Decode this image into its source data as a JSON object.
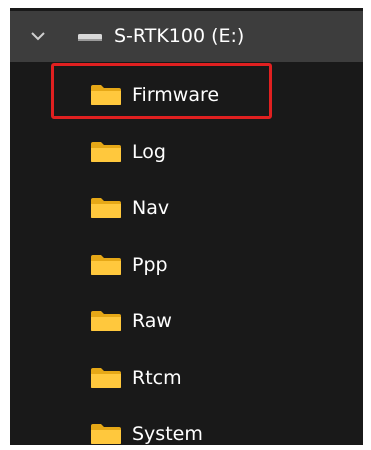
{
  "drive": {
    "label": "S-RTK100 (E:)",
    "icon": "drive-icon",
    "expand_icon": "chevron-down-icon"
  },
  "folders": [
    {
      "label": "Firmware",
      "icon": "folder-icon",
      "highlighted": true
    },
    {
      "label": "Log",
      "icon": "folder-icon"
    },
    {
      "label": "Nav",
      "icon": "folder-icon"
    },
    {
      "label": "Ppp",
      "icon": "folder-icon"
    },
    {
      "label": "Raw",
      "icon": "folder-icon"
    },
    {
      "label": "Rtcm",
      "icon": "folder-icon"
    },
    {
      "label": "System",
      "icon": "folder-icon"
    }
  ],
  "colors": {
    "panel_background": "#191919",
    "drive_row_background": "#3d3d3d",
    "folder_yellow": "#ffc83d",
    "highlight_border": "#e02020",
    "text": "#ffffff"
  }
}
